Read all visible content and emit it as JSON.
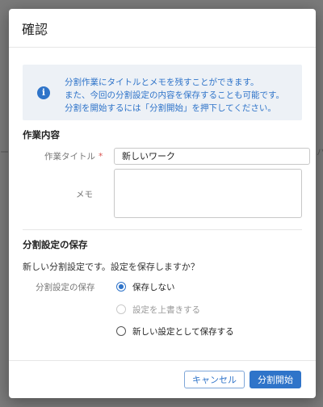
{
  "dialog": {
    "title": "確認",
    "info": {
      "icon": "info-icon",
      "lines": [
        "分割作業にタイトルとメモを残すことができます。",
        "また、今回の分割設定の内容を保存することも可能です。",
        "分割を開始するには「分割開始」を押下してください。"
      ]
    },
    "work_section": {
      "title": "作業内容",
      "title_label": "作業タイトル",
      "required_mark": "*",
      "title_value": "新しいワーク",
      "memo_label": "メモ",
      "memo_value": ""
    },
    "save_section": {
      "title": "分割設定の保存",
      "question": "新しい分割設定です。設定を保存しますか？",
      "label": "分割設定の保存",
      "options": [
        {
          "label": "保存しない",
          "checked": true,
          "disabled": false
        },
        {
          "label": "設定を上書きする",
          "checked": false,
          "disabled": true
        },
        {
          "label": "新しい設定として保存する",
          "checked": false,
          "disabled": false
        }
      ]
    },
    "buttons": {
      "cancel": "キャンセル",
      "start": "分割開始"
    }
  },
  "colors": {
    "accent": "#2f74c9",
    "info_bg": "#edf1f6",
    "required": "#d9534f"
  }
}
